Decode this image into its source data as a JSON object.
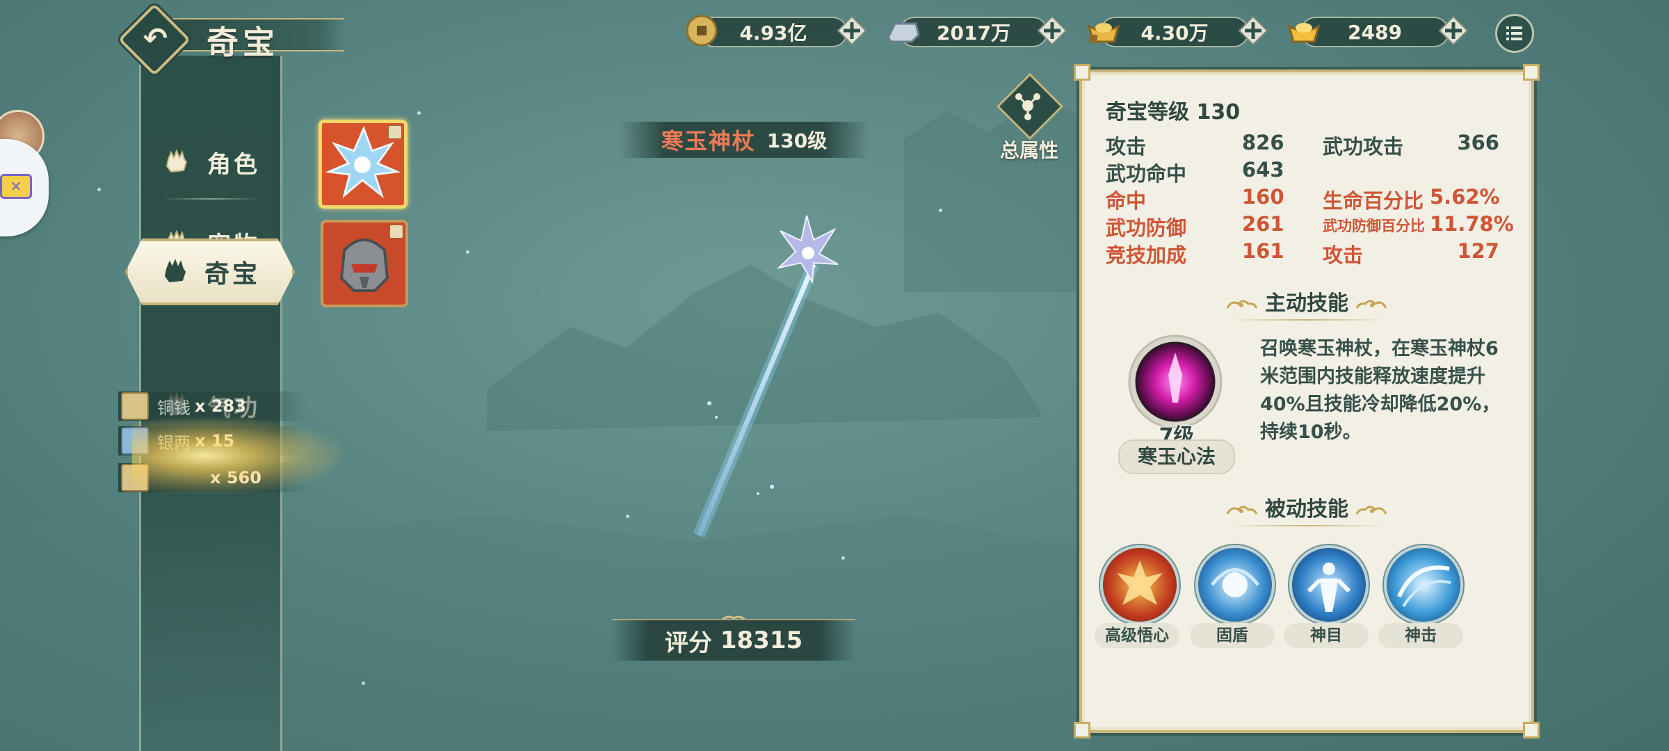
{
  "header": {
    "title": "奇宝",
    "back_icon": "back-arrow-icon"
  },
  "currencies": [
    {
      "name": "copper-coin",
      "icon": "copper-coin-icon",
      "value": "4.93亿",
      "color": "#d8b45a"
    },
    {
      "name": "silver-ingot",
      "icon": "silver-ingot-icon",
      "value": "2017万",
      "color": "#c7d2dc"
    },
    {
      "name": "bound-gold-ingot",
      "icon": "bound-gold-ingot-icon",
      "value": "4.30万",
      "color": "#e9b743"
    },
    {
      "name": "gold-ingot",
      "icon": "gold-ingot-icon",
      "value": "2489",
      "color": "#f0be3a"
    }
  ],
  "nav": {
    "items": [
      {
        "label": "角色",
        "icon": "fist-icon"
      },
      {
        "label": "宠物",
        "icon": "fist-icon"
      },
      {
        "label": "奇宝",
        "icon": "fist-icon",
        "active": true
      },
      {
        "label": "气功",
        "icon": "fist-icon"
      }
    ]
  },
  "rewards": [
    {
      "name": "铜钱",
      "count": "x 283"
    },
    {
      "name": "银两",
      "count": "x 15"
    },
    {
      "name": "",
      "count": "x 560"
    }
  ],
  "item": {
    "name": "寒玉神杖",
    "level": "130级",
    "score_label": "评分",
    "score": "18315"
  },
  "total_attr": {
    "label": "总属性"
  },
  "panel": {
    "title": "奇宝等级 130",
    "stats_left": [
      {
        "label": "攻击",
        "value": "826",
        "highlight": false
      },
      {
        "label": "武功命中",
        "value": "643",
        "highlight": false
      },
      {
        "label": "命中",
        "value": "160",
        "highlight": true
      },
      {
        "label": "武功防御",
        "value": "261",
        "highlight": true
      },
      {
        "label": "竞技加成",
        "value": "161",
        "highlight": true
      }
    ],
    "stats_right": [
      {
        "label": "武功攻击",
        "value": "366",
        "highlight": false
      },
      {
        "label": "生命百分比",
        "value": "5.62%",
        "highlight": true
      },
      {
        "label": "武功防御百分比",
        "value": "11.78%",
        "highlight": true
      },
      {
        "label": "攻击",
        "value": "127",
        "highlight": true
      }
    ],
    "active_skill": {
      "heading": "主动技能",
      "level": "7级",
      "name": "寒玉心法",
      "desc": "召唤寒玉神杖，在寒玉神杖6米范围内技能释放速度提升40%且技能冷却降低20%，持续10秒。"
    },
    "passive_skill": {
      "heading": "被动技能",
      "items": [
        {
          "name": "高级悟心",
          "icon": "phoenix-icon"
        },
        {
          "name": "固盾",
          "icon": "shield-swirl-icon"
        },
        {
          "name": "神目",
          "icon": "body-aura-icon"
        },
        {
          "name": "神击",
          "icon": "strike-swirl-icon"
        }
      ]
    }
  },
  "colors": {
    "panel_bg": "#f2efe4",
    "gold_border": "#cbb77a",
    "highlight_red": "#cf5535",
    "dark_text": "#36504a",
    "item_name": "#f07a55"
  }
}
